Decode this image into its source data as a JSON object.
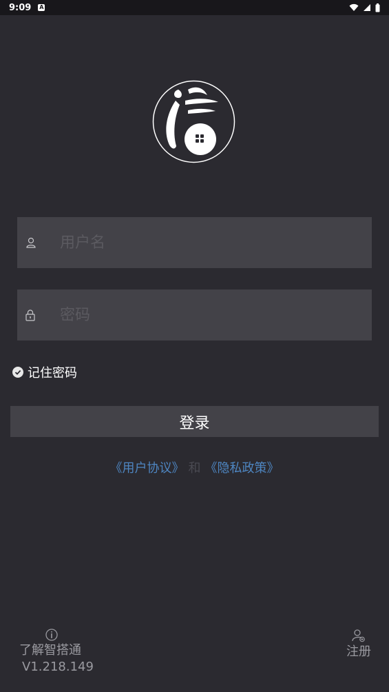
{
  "status_bar": {
    "time": "9:09",
    "notification_letter": "A",
    "icons": [
      "wifi-icon",
      "signal-icon",
      "battery-icon"
    ]
  },
  "logo": {
    "icon": "app-logo-icon"
  },
  "login_form": {
    "username": {
      "placeholder": "用户名",
      "value": "",
      "icon": "user-icon"
    },
    "password": {
      "placeholder": "密码",
      "value": "",
      "icon": "lock-icon"
    },
    "remember_label": "记住密码",
    "remember_checked": true,
    "login_label": "登录"
  },
  "agreement": {
    "user_agreement": "《用户协议》",
    "and_text": "和",
    "privacy_policy": "《隐私政策》"
  },
  "footer": {
    "about_label": "了解智搭通",
    "version": "V1.218.149",
    "register_label": "注册"
  },
  "colors": {
    "background": "#2b2a30",
    "field": "#434248",
    "link": "#4e86c2",
    "muted": "#9a9aa0"
  }
}
